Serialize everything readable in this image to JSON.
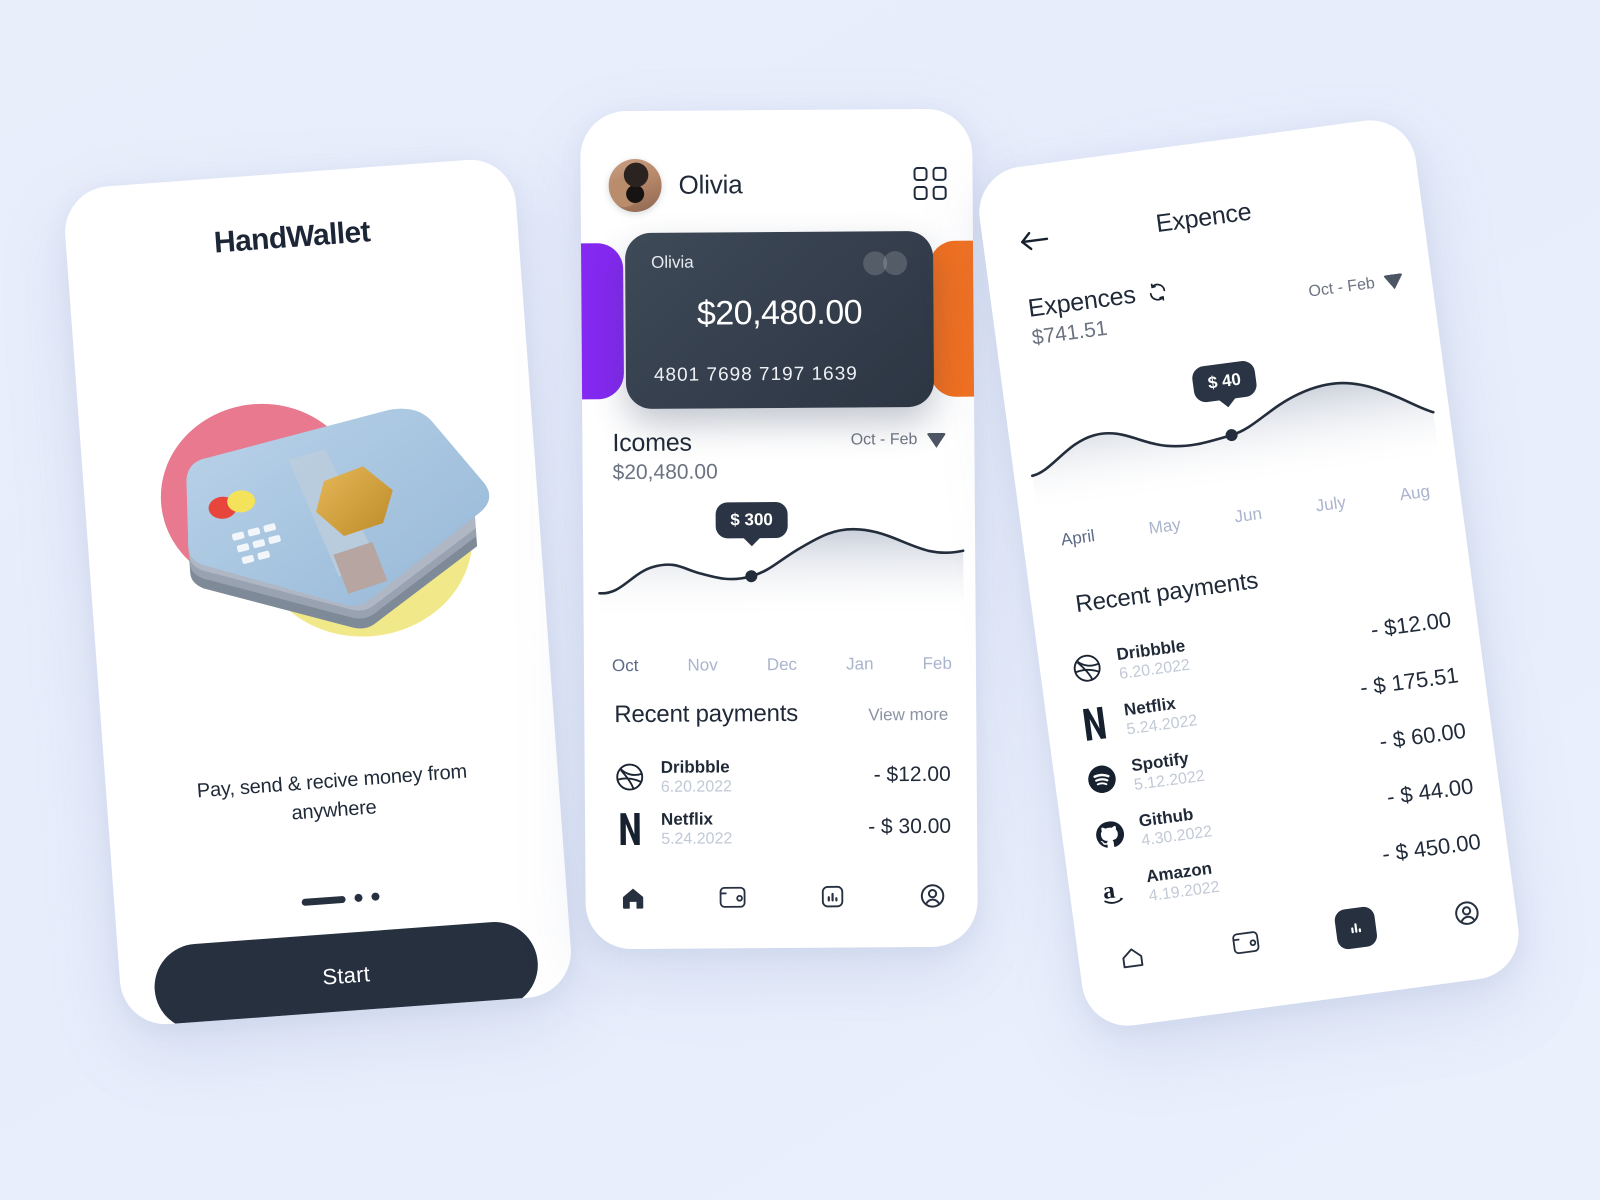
{
  "theme": {
    "background": "#e9eefb",
    "dark": "#26303f",
    "muted": "#6b7280",
    "card_purple": "#8429f0",
    "card_orange": "#f2701f",
    "blob_pink": "#e8798e",
    "blob_yellow": "#f0e67f"
  },
  "screen1": {
    "brand": "HandWallet",
    "illustration": "3d-wallet-card-stack",
    "tagline": "Pay, send & recive money from anywhere",
    "pager": {
      "active_index": 0,
      "count": 3
    },
    "start_label": "Start"
  },
  "screen2": {
    "header": {
      "user_name": "Olivia",
      "avatar": "user-avatar",
      "menu_icon": "grid-menu-icon"
    },
    "card": {
      "holder": "Olivia",
      "balance": "$20,480.00",
      "number": "4801  7698  7197  1639",
      "brand_mark": "mastercard-circles"
    },
    "carousel": {
      "left_card_color": "#8429f0",
      "right_card_color": "#f2701f"
    },
    "incomes": {
      "title": "Icomes",
      "amount": "$20,480.00",
      "range_label": "Oct - Feb"
    },
    "recent": {
      "title": "Recent payments",
      "view_more": "View more",
      "items": [
        {
          "icon": "dribbble-icon",
          "name": "Dribbble",
          "date": "6.20.2022",
          "amount": "- $12.00"
        },
        {
          "icon": "netflix-icon",
          "name": "Netflix",
          "date": "5.24.2022",
          "amount": "- $ 30.00"
        }
      ]
    },
    "nav": [
      {
        "icon": "home-icon",
        "active": true
      },
      {
        "icon": "wallet-icon",
        "active": false
      },
      {
        "icon": "chart-icon",
        "active": false
      },
      {
        "icon": "profile-icon",
        "active": false
      }
    ],
    "chart_data": {
      "type": "area",
      "title": "Icomes",
      "categories": [
        "Oct",
        "Nov",
        "Dec",
        "Jan",
        "Feb"
      ],
      "values": [
        60,
        160,
        130,
        300,
        265
      ],
      "active_category": "Oct",
      "highlight": {
        "category": "Dec",
        "label": "$ 300",
        "value": 300
      },
      "xlabel": "",
      "ylabel": "",
      "grid": false,
      "legend": "none"
    }
  },
  "screen3": {
    "header": {
      "back_icon": "back-arrow-icon",
      "title": "Expence"
    },
    "summary": {
      "label": "Expences",
      "amount": "$741.51",
      "refresh_icon": "refresh-icon",
      "range_label": "Oct - Feb"
    },
    "recent": {
      "title": "Recent payments",
      "items": [
        {
          "icon": "dribbble-icon",
          "name": "Dribbble",
          "date": "6.20.2022",
          "amount": "- $12.00"
        },
        {
          "icon": "netflix-icon",
          "name": "Netflix",
          "date": "5.24.2022",
          "amount": "- $ 175.51"
        },
        {
          "icon": "spotify-icon",
          "name": "Spotify",
          "date": "5.12.2022",
          "amount": "- $ 60.00"
        },
        {
          "icon": "github-icon",
          "name": "Github",
          "date": "4.30.2022",
          "amount": "- $ 44.00"
        },
        {
          "icon": "amazon-icon",
          "name": "Amazon",
          "date": "4.19.2022",
          "amount": "- $ 450.00"
        }
      ]
    },
    "nav": [
      {
        "icon": "home-icon",
        "active": false
      },
      {
        "icon": "wallet-icon",
        "active": false
      },
      {
        "icon": "chart-icon",
        "active": true
      },
      {
        "icon": "profile-icon",
        "active": false
      }
    ],
    "chart_data": {
      "type": "area",
      "title": "Expences",
      "categories": [
        "April",
        "May",
        "Jun",
        "July",
        "Aug"
      ],
      "values": [
        20,
        48,
        32,
        40,
        70
      ],
      "active_category": "April",
      "highlight": {
        "category": "Jun",
        "label": "$ 40",
        "value": 40
      },
      "xlabel": "",
      "ylabel": "",
      "grid": false,
      "legend": "none"
    }
  }
}
